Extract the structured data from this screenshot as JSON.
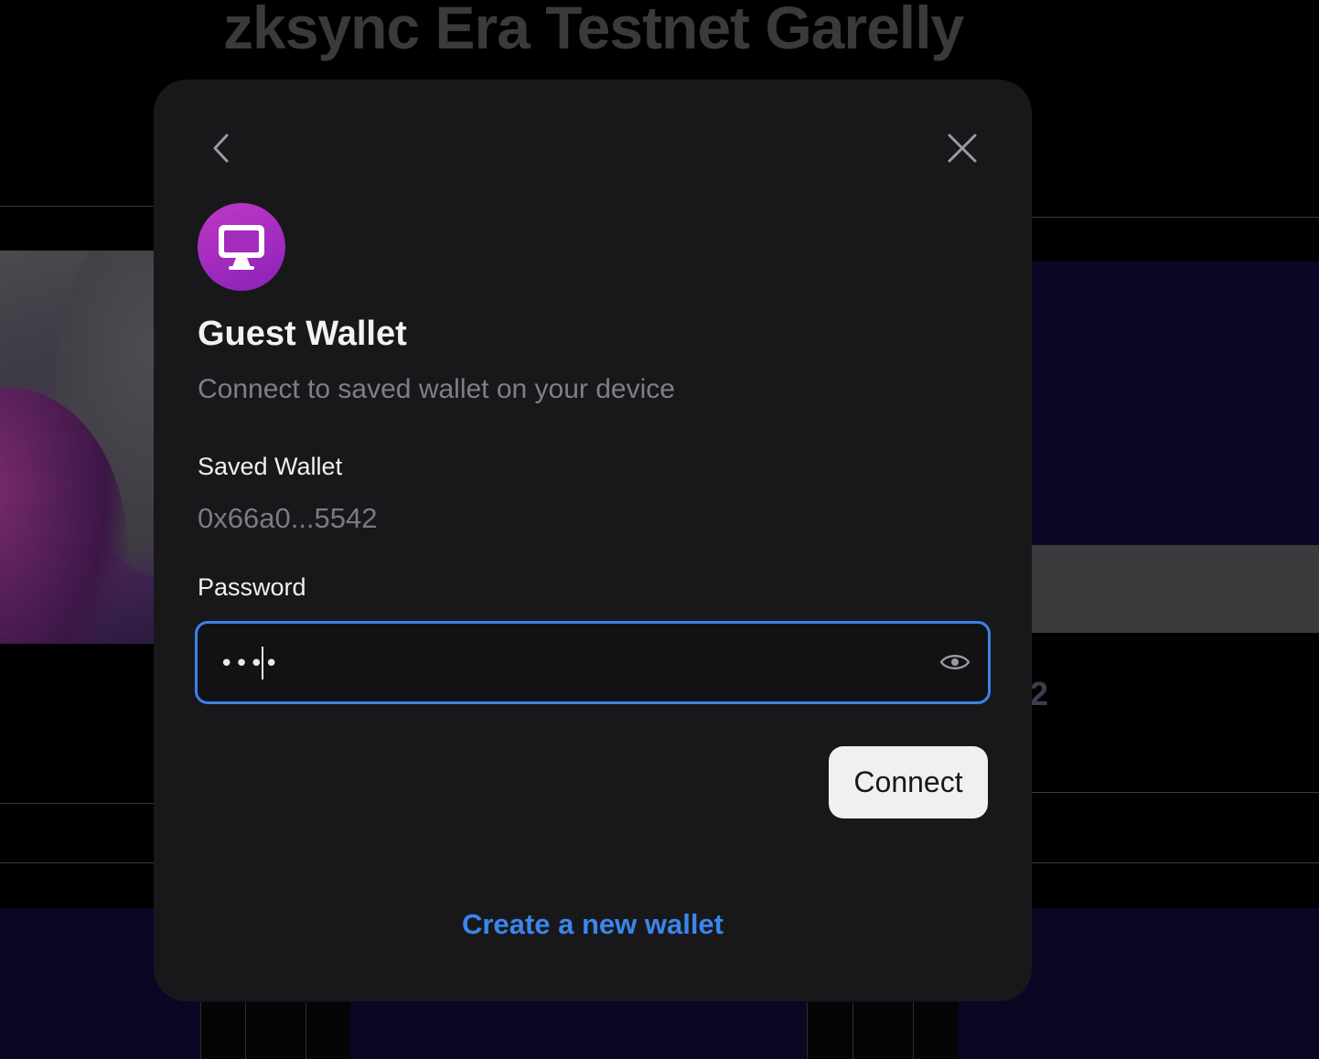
{
  "background": {
    "page_title": "zksync Era Testnet Garelly",
    "partial_digit": "2"
  },
  "modal": {
    "back_icon": "chevron-left-icon",
    "close_icon": "close-icon",
    "wallet_icon": "monitor-icon",
    "title": "Guest Wallet",
    "subtitle": "Connect to saved wallet on your device",
    "saved_wallet_label": "Saved Wallet",
    "saved_wallet_address": "0x66a0...5542",
    "password_label": "Password",
    "password_value": "••••",
    "password_toggle_icon": "eye-icon",
    "connect_label": "Connect",
    "create_wallet_label": "Create a new wallet"
  },
  "colors": {
    "modal_bg": "#18181b",
    "accent": "#3a86ec",
    "avatar_gradient_start": "#c037c6",
    "avatar_gradient_end": "#8a22b8"
  }
}
